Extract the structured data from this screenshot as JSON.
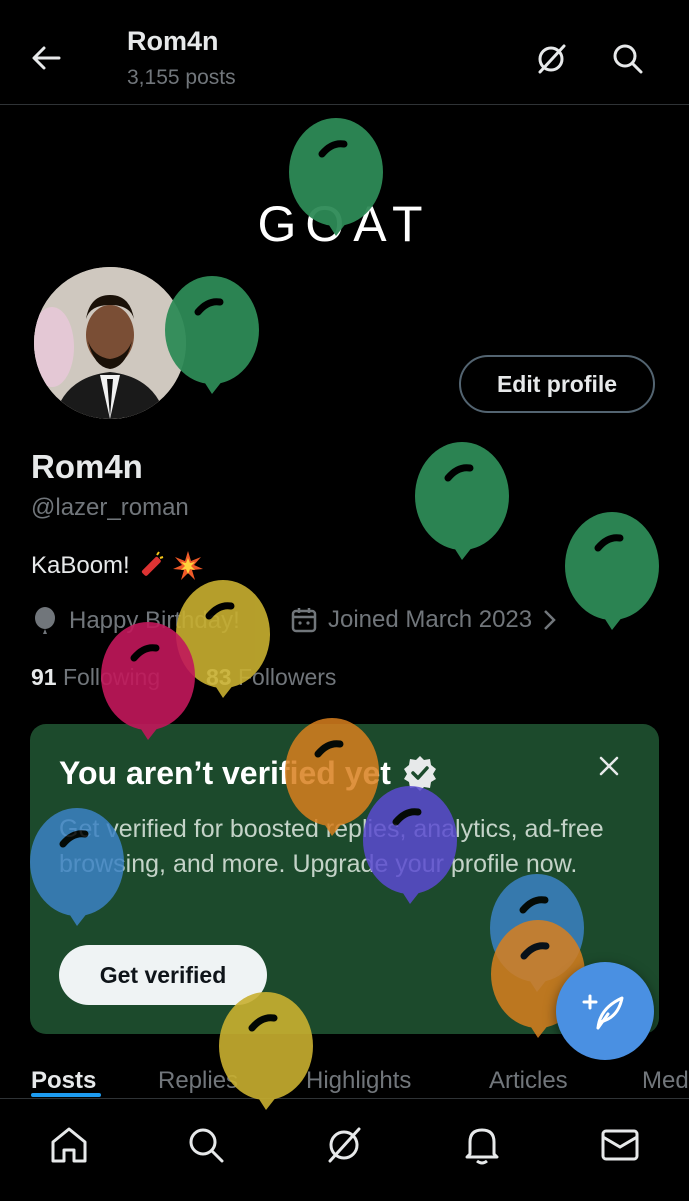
{
  "header": {
    "title": "Rom4n",
    "subtitle": "3,155 posts",
    "back_icon": "back-arrow-icon",
    "grok_icon": "grok-icon",
    "search_icon": "search-icon"
  },
  "banner": {
    "text": "GOAT"
  },
  "profile": {
    "edit_label": "Edit profile",
    "name": "Rom4n",
    "handle": "@lazer_roman",
    "bio": "KaBoom!",
    "birthday": "Happy Birthday!",
    "joined": "Joined March 2023",
    "following_count": "91",
    "following_label": "Following",
    "followers_count": "83",
    "followers_label": "Followers"
  },
  "verify_card": {
    "title": "You aren’t verified yet",
    "text": "Get verified for boosted replies, analytics, ad-free browsing, and more. Upgrade your profile now.",
    "button": "Get verified",
    "bg_color": "#1c4a2c"
  },
  "tabs": [
    "Posts",
    "Replies",
    "Highlights",
    "Articles",
    "Med"
  ],
  "nav": [
    "home-icon",
    "search-icon",
    "grok-icon",
    "bell-icon",
    "mail-icon"
  ],
  "colors": {
    "accent": "#1d9bf0",
    "balloon_green": "#2e8b57",
    "balloon_yellow": "#c9b030",
    "balloon_pink": "#c2185b",
    "balloon_orange": "#d97f1e",
    "balloon_purple": "#5b4bd1",
    "balloon_blue": "#3b82c4"
  }
}
